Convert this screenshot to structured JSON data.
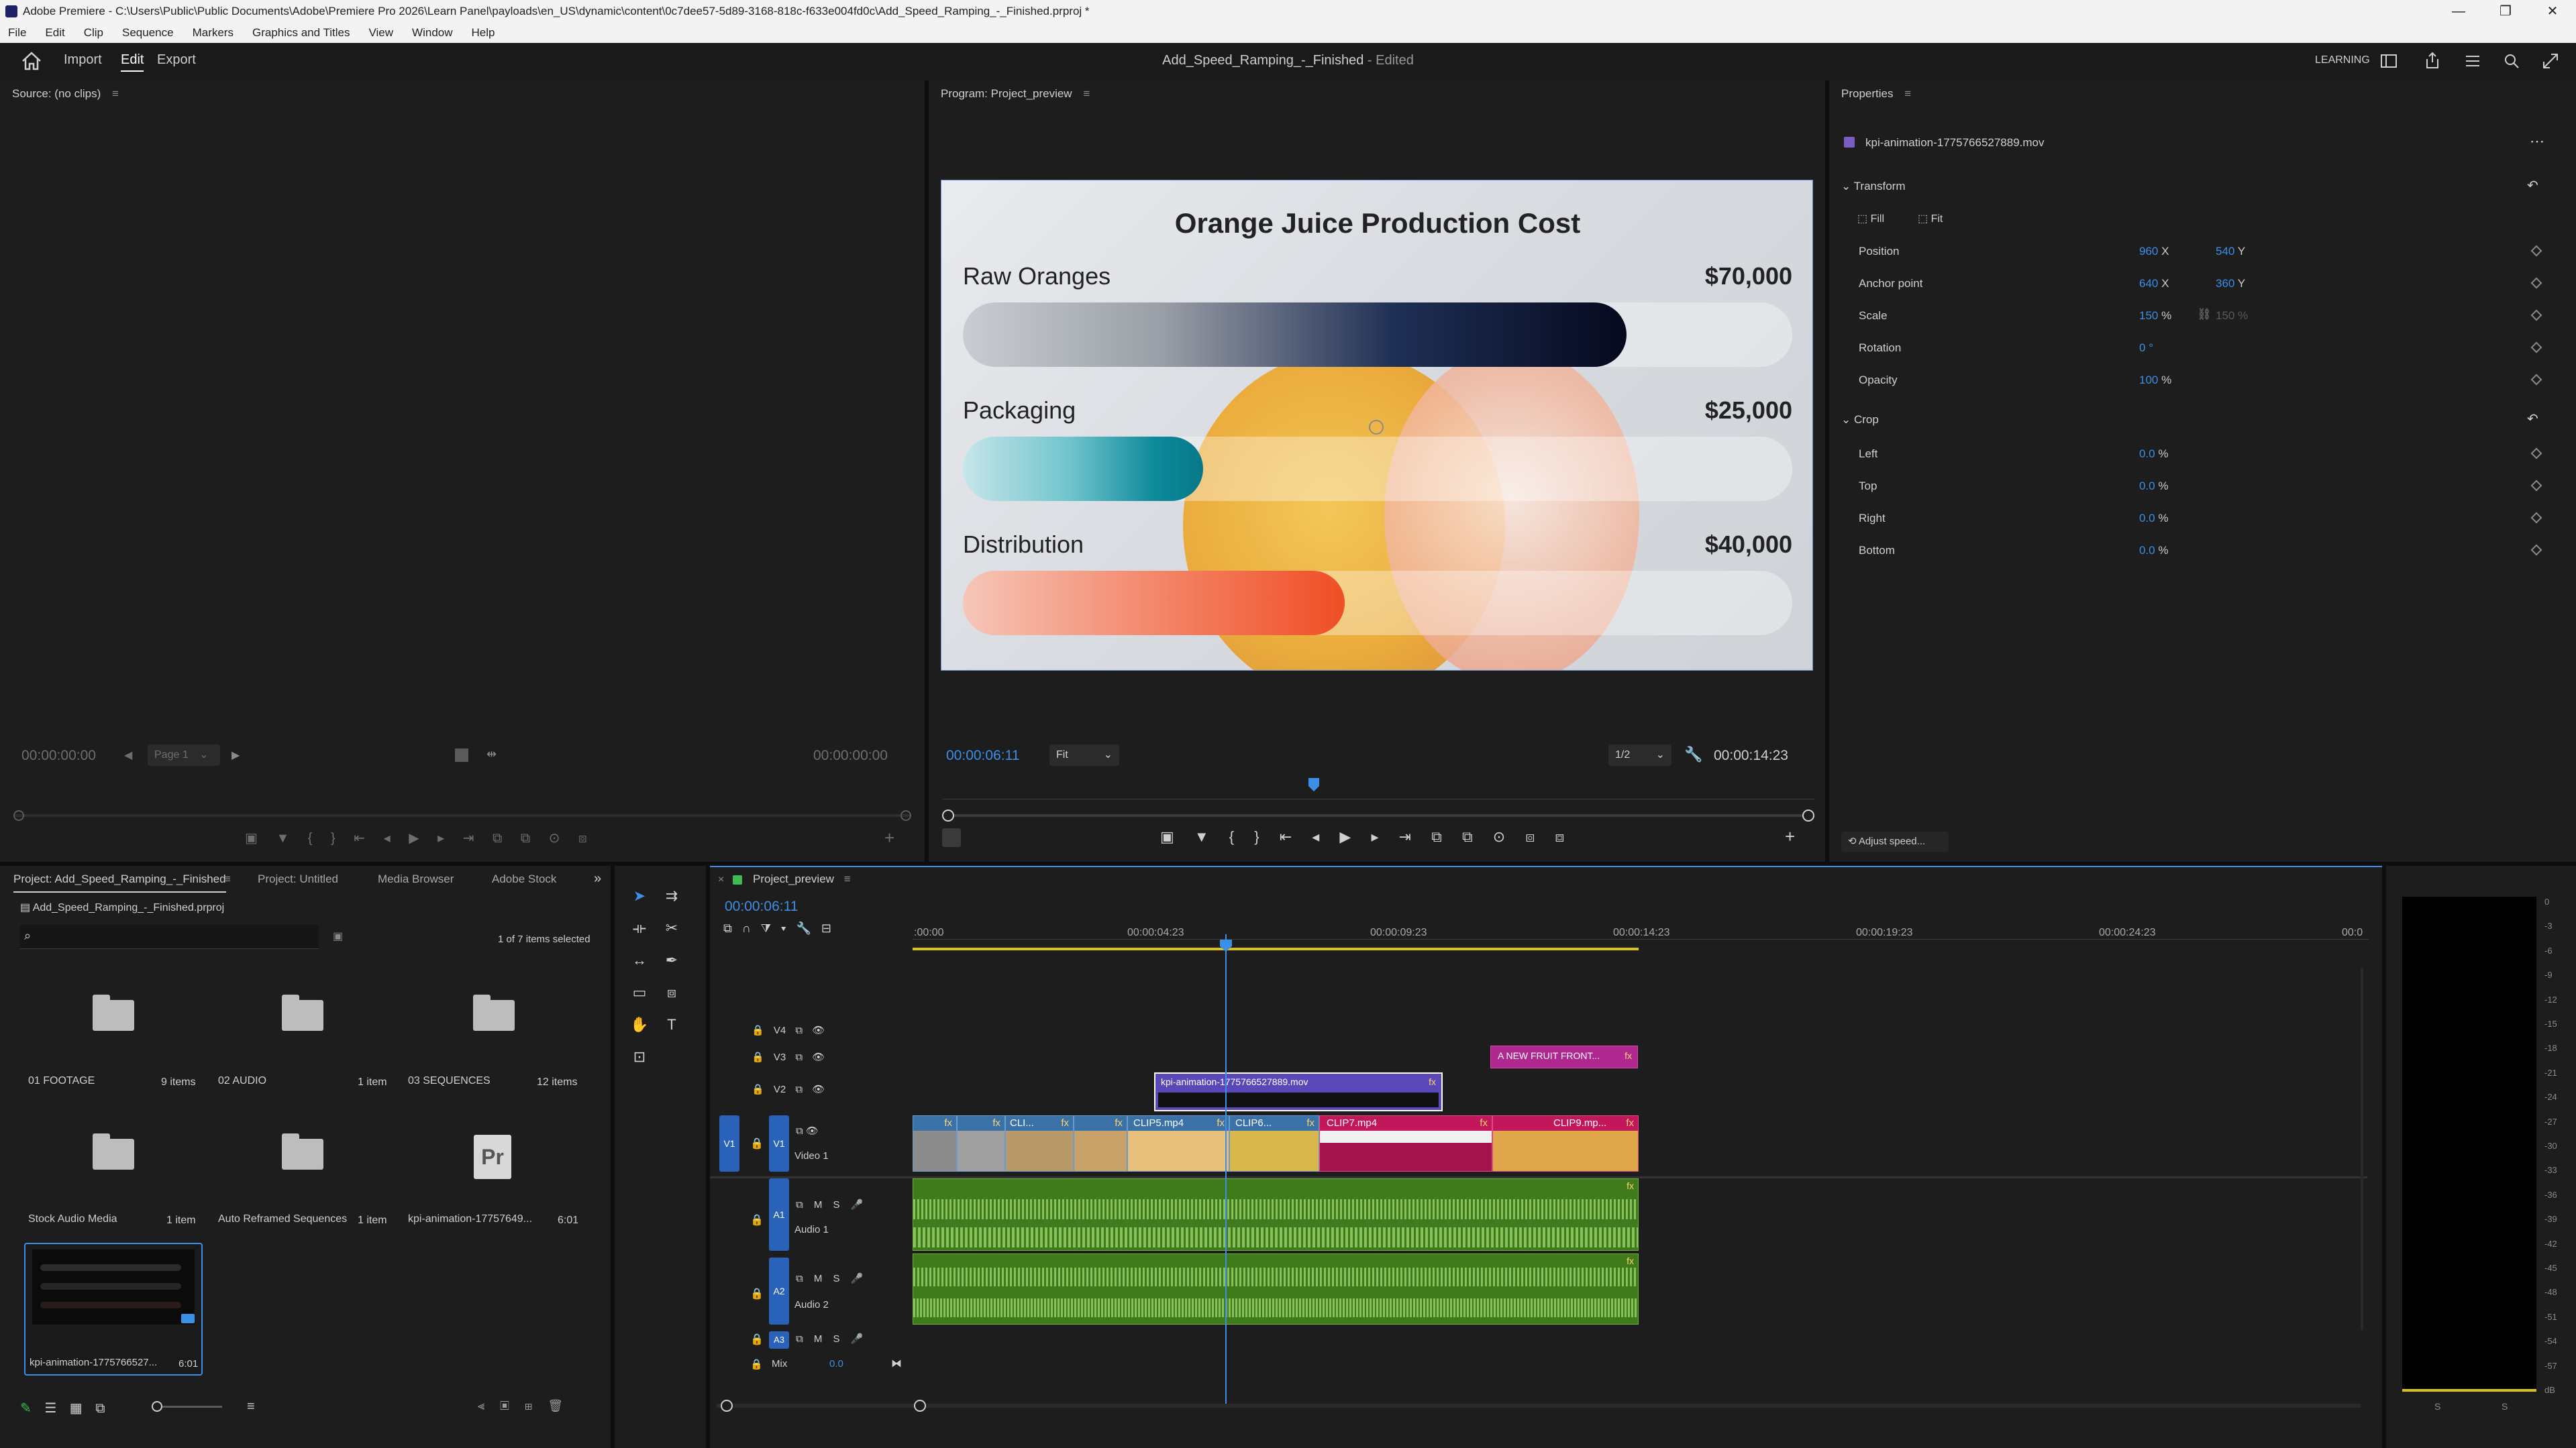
{
  "window": {
    "title": "Adobe Premiere - C:\\Users\\Public\\Public Documents\\Adobe\\Premiere Pro 2026\\Learn Panel\\payloads\\en_US\\dynamic\\content\\0c7dee57-5d89-3168-818c-f633e004fd0c\\Add_Speed_Ramping_-_Finished.prproj *",
    "controls": [
      "—",
      "❐",
      "✕"
    ]
  },
  "menu": [
    "File",
    "Edit",
    "Clip",
    "Sequence",
    "Markers",
    "Graphics and Titles",
    "View",
    "Window",
    "Help"
  ],
  "appbar": {
    "import": "Import",
    "edit": "Edit",
    "export": "Export",
    "doc_title": "Add_Speed_Ramping_-_Finished",
    "doc_status": "- Edited",
    "learning": "LEARNING"
  },
  "source": {
    "title": "Source: (no clips)",
    "tc_left": "00:00:00:00",
    "page": "Page 1",
    "tc_right": "00:00:00:00"
  },
  "program": {
    "title": "Program: Project_preview",
    "tc_current": "00:00:06:11",
    "fit": "Fit",
    "res": "1/2",
    "tc_duration": "00:00:14:23"
  },
  "kpi": {
    "title": "Orange Juice Production Cost",
    "rows": [
      {
        "label": "Raw Oranges",
        "value": "$70,000",
        "fill": 0.8
      },
      {
        "label": "Packaging",
        "value": "$25,000",
        "fill": 0.29
      },
      {
        "label": "Distribution",
        "value": "$40,000",
        "fill": 0.46
      }
    ]
  },
  "properties": {
    "title": "Properties",
    "clip": "kpi-animation-1775766527889.mov",
    "transform": "Transform",
    "fill": "Fill",
    "fit": "Fit",
    "position": "Position",
    "pos_x": "960",
    "pos_y": "540",
    "anchor": "Anchor point",
    "anc_x": "640",
    "anc_y": "360",
    "scale": "Scale",
    "scale_v": "150",
    "scale_v2": "150",
    "rotation": "Rotation",
    "rot_v": "0",
    "opacity": "Opacity",
    "op_v": "100",
    "crop": "Crop",
    "left": "Left",
    "top": "Top",
    "right": "Right",
    "bottom": "Bottom",
    "crop_v": "0.0",
    "adjust": "Adjust speed..."
  },
  "project": {
    "tabs": [
      "Project: Add_Speed_Ramping_-_Finished",
      "Project: Untitled",
      "Media Browser",
      "Adobe Stock"
    ],
    "file": "Add_Speed_Ramping_-_Finished.prproj",
    "selected": "1 of 7 items selected",
    "items": [
      {
        "name": "01 FOOTAGE",
        "meta": "9 items"
      },
      {
        "name": "02 AUDIO",
        "meta": "1 item"
      },
      {
        "name": "03 SEQUENCES",
        "meta": "12 items"
      },
      {
        "name": "Stock Audio Media",
        "meta": "1 item"
      },
      {
        "name": "Auto Reframed Sequences",
        "meta": "1 item"
      },
      {
        "name": "kpi-animation-17757649...",
        "meta": "6:01"
      },
      {
        "name": "kpi-animation-1775766527...",
        "meta": "6:01"
      }
    ]
  },
  "timeline": {
    "tab": "Project_preview",
    "tc": "00:00:06:11",
    "ruler": [
      ":00:00",
      "00:00:04:23",
      "00:00:09:23",
      "00:00:14:23",
      "00:00:19:23",
      "00:00:24:23",
      "00:0"
    ],
    "tracks": {
      "v4": "V4",
      "v3": "V3",
      "v2": "V2",
      "v1": "V1",
      "video1": "Video 1",
      "a1": "A1",
      "audio1": "Audio 1",
      "a2": "A2",
      "audio2": "Audio 2",
      "a3": "A3",
      "mix": "Mix",
      "mix_v": "0.0"
    },
    "clips": {
      "v2": "kpi-animation-1775766527889.mov",
      "v3": "A NEW FRUIT FRONT...",
      "c1": "CLI...",
      "c5": "CLIP5.mp4",
      "c6": "CLIP6...",
      "c7": "CLIP7.mp4",
      "c9": "CLIP9.mp..."
    }
  },
  "meter": {
    "labels": [
      "0",
      "-3",
      "-6",
      "-9",
      "-12",
      "-15",
      "-18",
      "-21",
      "-24",
      "-27",
      "-30",
      "-33",
      "-36",
      "-39",
      "-42",
      "-45",
      "-48",
      "-51",
      "-54",
      "-57",
      "dB"
    ],
    "solo": "S"
  },
  "colors": {
    "accent": "#3b8fe6",
    "video_clip": "#3a72a8",
    "v3_clip": "#b0288f",
    "v1_pink": "#c2185b",
    "audio": "#3f7a1d"
  }
}
